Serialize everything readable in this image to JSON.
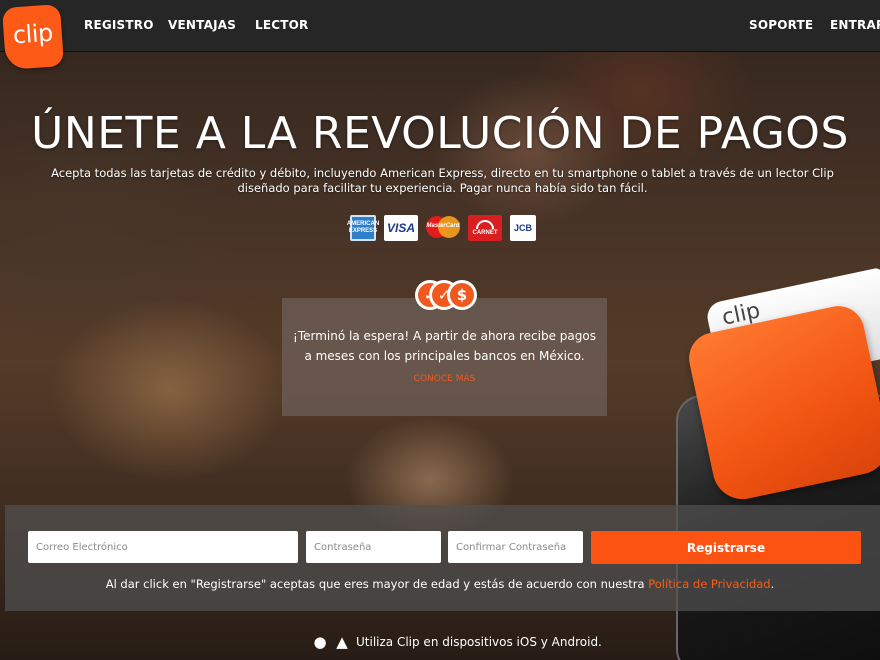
{
  "nav": {
    "logo_text": "clip",
    "links_left": [
      "REGISTRO",
      "VENTAJAS",
      "LECTOR"
    ],
    "links_right": [
      "SOPORTE",
      "ENTRAR"
    ]
  },
  "hero": {
    "title": "ÚNETE A LA REVOLUCIÓN DE PAGOS",
    "subtitle": "Acepta todas las tarjetas de crédito y débito, incluyendo American Express, directo en tu smartphone o tablet a través de un lector Clip diseñado para facilitar tu experiencia. Pagar nunca había sido tan fácil.",
    "cards": [
      {
        "name": "amex",
        "label": "AMERICAN EXPRESS"
      },
      {
        "name": "visa",
        "label": "VISA"
      },
      {
        "name": "mastercard",
        "label": "MasterCard"
      },
      {
        "name": "carnet",
        "label": "CARNET"
      },
      {
        "name": "jcb",
        "label": "JCB"
      }
    ]
  },
  "promo": {
    "icons": [
      "✓",
      "✓",
      "$"
    ],
    "text_line1": "¡Terminó la espera! A partir de ahora recibe pagos",
    "text_line2": "a meses con los principales bancos en México.",
    "link": "CONOCE MÁS"
  },
  "device": {
    "reader_label": "clip"
  },
  "form": {
    "email_placeholder": "Correo Electrónico",
    "password_placeholder": "Contraseña",
    "confirm_placeholder": "Confirmar Contraseña",
    "submit_label": "Registrarse",
    "terms_prefix": "Al dar click en \"Registrarse\" aceptas que eres mayor de edad y estás de acuerdo con nuestra ",
    "terms_link": "Política de Privacidad",
    "terms_suffix": "."
  },
  "footer": {
    "text": "Utiliza Clip en dispositivos iOS y Android."
  },
  "colors": {
    "accent": "#fc5a16",
    "nav_bg": "#262626"
  }
}
